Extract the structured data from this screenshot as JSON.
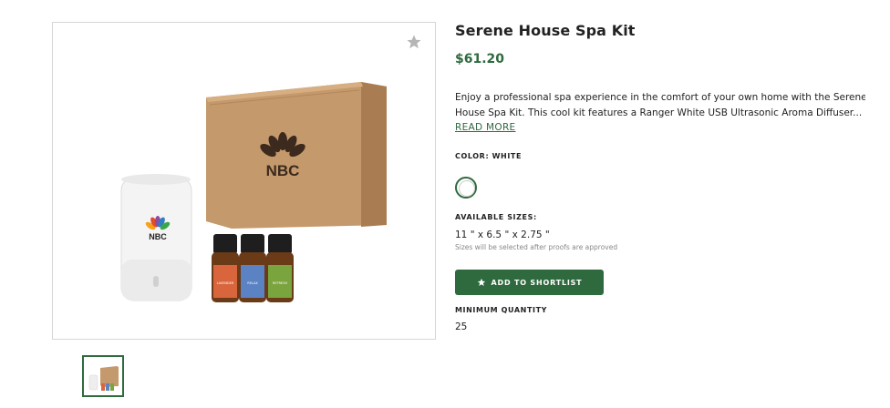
{
  "product": {
    "title": "Serene House Spa Kit",
    "price": "$61.20",
    "description_lines": [
      "Enjoy a professional spa experience in the comfort of your own home with the Serene",
      "House Spa Kit. This cool kit features a Ranger White USB Ultrasonic Aroma Diffuser..."
    ],
    "read_more": "READ MORE",
    "color_label": "COLOR: WHITE",
    "sizes_label": "AVAILABLE SIZES:",
    "size_value": "11 \" x 6.5 \" x 2.75 \"",
    "size_note": "Sizes will be selected after proofs are approved",
    "shortlist_button": "ADD TO SHORTLIST",
    "min_qty_label": "MINIMUM QUANTITY",
    "min_qty_value": "25"
  },
  "image": {
    "logo_text": "NBC",
    "bottle_labels": [
      "LAVENDER",
      "RELAX",
      "REFRESH"
    ]
  },
  "colors": {
    "accent": "#2e6a3e",
    "box": "#c4996b",
    "bottle_orange": "#d8653c",
    "bottle_blue": "#5b83c4",
    "bottle_green": "#7aa43e"
  },
  "icons": {
    "favorite": "star-icon",
    "button": "star-icon"
  }
}
